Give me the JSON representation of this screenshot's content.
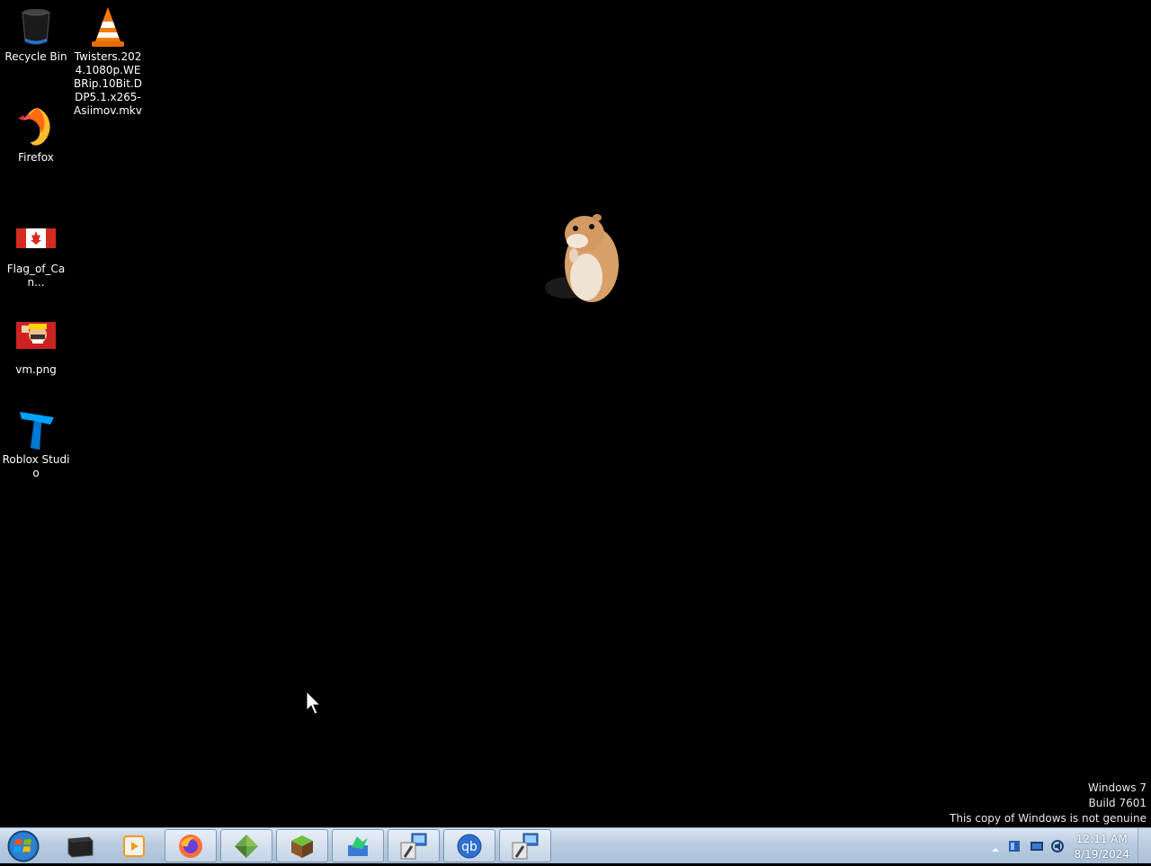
{
  "desktop": {
    "icons": [
      {
        "label": "Recycle Bin",
        "icon": "recycle-bin-icon"
      },
      {
        "label": "Twisters.2024.1080p.WEBRip.10Bit.DDP5.1.x265-Asiimov.mkv",
        "icon": "vlc-icon"
      },
      {
        "label": "Firefox",
        "icon": "firefox-icon"
      },
      {
        "label": "Flag_of_Can...",
        "icon": "canada-flag-icon"
      },
      {
        "label": "vm.png",
        "icon": "image-thumbnail-icon"
      },
      {
        "label": "Roblox Studio",
        "icon": "roblox-studio-icon"
      }
    ],
    "watermark": {
      "line1": "Windows 7",
      "line2": "Build 7601",
      "line3": "This copy of Windows is not genuine"
    }
  },
  "taskbar": {
    "buttons": [
      {
        "icon": "terminal-icon",
        "open": false
      },
      {
        "icon": "media-player-icon",
        "open": false
      },
      {
        "icon": "firefox-icon",
        "open": true
      },
      {
        "icon": "minecraft-grass-icon",
        "open": true
      },
      {
        "icon": "minecraft-block-icon",
        "open": true
      },
      {
        "icon": "installer-icon",
        "open": true
      },
      {
        "icon": "setup-wizard-icon",
        "open": true
      },
      {
        "icon": "qbittorrent-icon",
        "open": true
      },
      {
        "icon": "setup-wizard-icon",
        "open": true
      }
    ],
    "clock": {
      "time": "12:11 AM",
      "date": "8/19/2024"
    }
  },
  "colors": {
    "desktop_bg": "#000000",
    "taskbar_bg": "#b9cce0"
  }
}
